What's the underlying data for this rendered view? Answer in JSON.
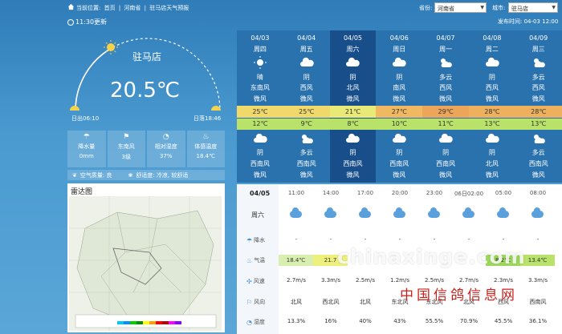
{
  "breadcrumb": {
    "prefix": "当前位置:",
    "items": [
      "首页",
      "河南省",
      "驻马店天气预报"
    ],
    "sep": "|"
  },
  "selectors": {
    "province_label": "省份:",
    "province_value": "河南省",
    "city_label": "城市:",
    "city_value": "驻马店"
  },
  "updated": "11:30更新",
  "published": "发布时间: 04-03 12:00",
  "current": {
    "city": "驻马店",
    "temp": "20.5℃",
    "sunrise": "日出06:10",
    "sunset": "日落18:46",
    "stats": [
      {
        "icon": "umbrella-icon",
        "label": "降水量",
        "value": "0mm"
      },
      {
        "icon": "wind-icon",
        "label": "东南风",
        "value": "3级"
      },
      {
        "icon": "droplet-icon",
        "label": "相对湿度",
        "value": "37%"
      },
      {
        "icon": "thermometer-icon",
        "label": "体感温度",
        "value": "18.4℃"
      }
    ],
    "air": "空气质量: 良",
    "comfort": "舒适度: 冷凉, 较舒适"
  },
  "radar": {
    "title": "雷达图"
  },
  "daily": [
    {
      "date": "04/03",
      "week": "周四",
      "cond1": "晴",
      "wind1": "东南风",
      "lvl1": "微风",
      "hi": "25℃",
      "lo": "12℃",
      "cond2": "阴",
      "wind2": "西南风",
      "lvl2": "微风",
      "hi_color": "#f0d86a",
      "icon1": "sun-icon",
      "icon2": "cloud-icon"
    },
    {
      "date": "04/04",
      "week": "周五",
      "cond1": "阴",
      "wind1": "西风",
      "lvl1": "微风",
      "hi": "25℃",
      "lo": "9℃",
      "cond2": "多云",
      "wind2": "西南风",
      "lvl2": "微风",
      "hi_color": "#f0d86a",
      "icon1": "cloud-icon",
      "icon2": "partly-cloudy-icon"
    },
    {
      "date": "04/05",
      "week": "周六",
      "cond1": "阴",
      "wind1": "北风",
      "lvl1": "微风",
      "hi": "21℃",
      "lo": "8℃",
      "cond2": "阴",
      "wind2": "西南风",
      "lvl2": "微风",
      "hi_color": "#e9e978",
      "icon1": "cloud-icon",
      "icon2": "cloud-icon"
    },
    {
      "date": "04/06",
      "week": "周日",
      "cond1": "阴",
      "wind1": "南风",
      "lvl1": "微风",
      "hi": "27℃",
      "lo": "10℃",
      "cond2": "阴",
      "wind2": "西南风",
      "lvl2": "微风",
      "hi_color": "#f0b860",
      "icon1": "cloud-icon",
      "icon2": "cloud-icon"
    },
    {
      "date": "04/07",
      "week": "周一",
      "cond1": "多云",
      "wind1": "西风",
      "lvl1": "微风",
      "hi": "29℃",
      "lo": "11℃",
      "cond2": "阴",
      "wind2": "西南风",
      "lvl2": "微风",
      "hi_color": "#eda55a",
      "icon1": "partly-cloudy-icon",
      "icon2": "cloud-icon"
    },
    {
      "date": "04/08",
      "week": "周二",
      "cond1": "阴",
      "wind1": "西风",
      "lvl1": "微风",
      "hi": "28℃",
      "lo": "13℃",
      "cond2": "阴",
      "wind2": "北风",
      "lvl2": "微风",
      "hi_color": "#eeb05d",
      "icon1": "cloud-icon",
      "icon2": "cloud-icon"
    },
    {
      "date": "04/09",
      "week": "周三",
      "cond1": "多云",
      "wind1": "西风",
      "lvl1": "微风",
      "hi": "28℃",
      "lo": "13℃",
      "cond2": "多云",
      "wind2": "西南风",
      "lvl2": "微风",
      "hi_color": "#eeb05d",
      "icon1": "partly-cloudy-icon",
      "icon2": "partly-cloudy-icon"
    }
  ],
  "lo_color": "#b8e26a",
  "hourly": {
    "date": "04/05",
    "week": "周六",
    "labels": {
      "rain": "降水",
      "temp": "气温",
      "wind_speed": "风速",
      "wind_dir": "风向",
      "humidity": "湿度"
    },
    "times": [
      "11:00",
      "14:00",
      "17:00",
      "20:00",
      "23:00",
      "06日02:00",
      "05:00",
      "08:00"
    ],
    "rain": [
      "-",
      "-",
      "-",
      "-",
      "-",
      "-",
      "-",
      "-"
    ],
    "temps": [
      "18.4℃",
      "21.7",
      "",
      "",
      "",
      "",
      "8.2℃",
      "13.4℃"
    ],
    "wind_speed": [
      "2.7m/s",
      "3.3m/s",
      "2.5m/s",
      "1.2m/s",
      "2.5m/s",
      "2.7m/s",
      "2.3m/s",
      "3.3m/s"
    ],
    "wind_dir": [
      "北风",
      "西北风",
      "北风",
      "东北风",
      "东北风",
      "北风",
      "西风",
      "西南风"
    ],
    "humidity": [
      "13.3%",
      "16%",
      "40%",
      "43%",
      "55.5%",
      "70.9%",
      "45.5%",
      "36.1%"
    ]
  },
  "watermark": {
    "en": "chinaxinge.com",
    "cn": "中国信鸽信息网"
  }
}
